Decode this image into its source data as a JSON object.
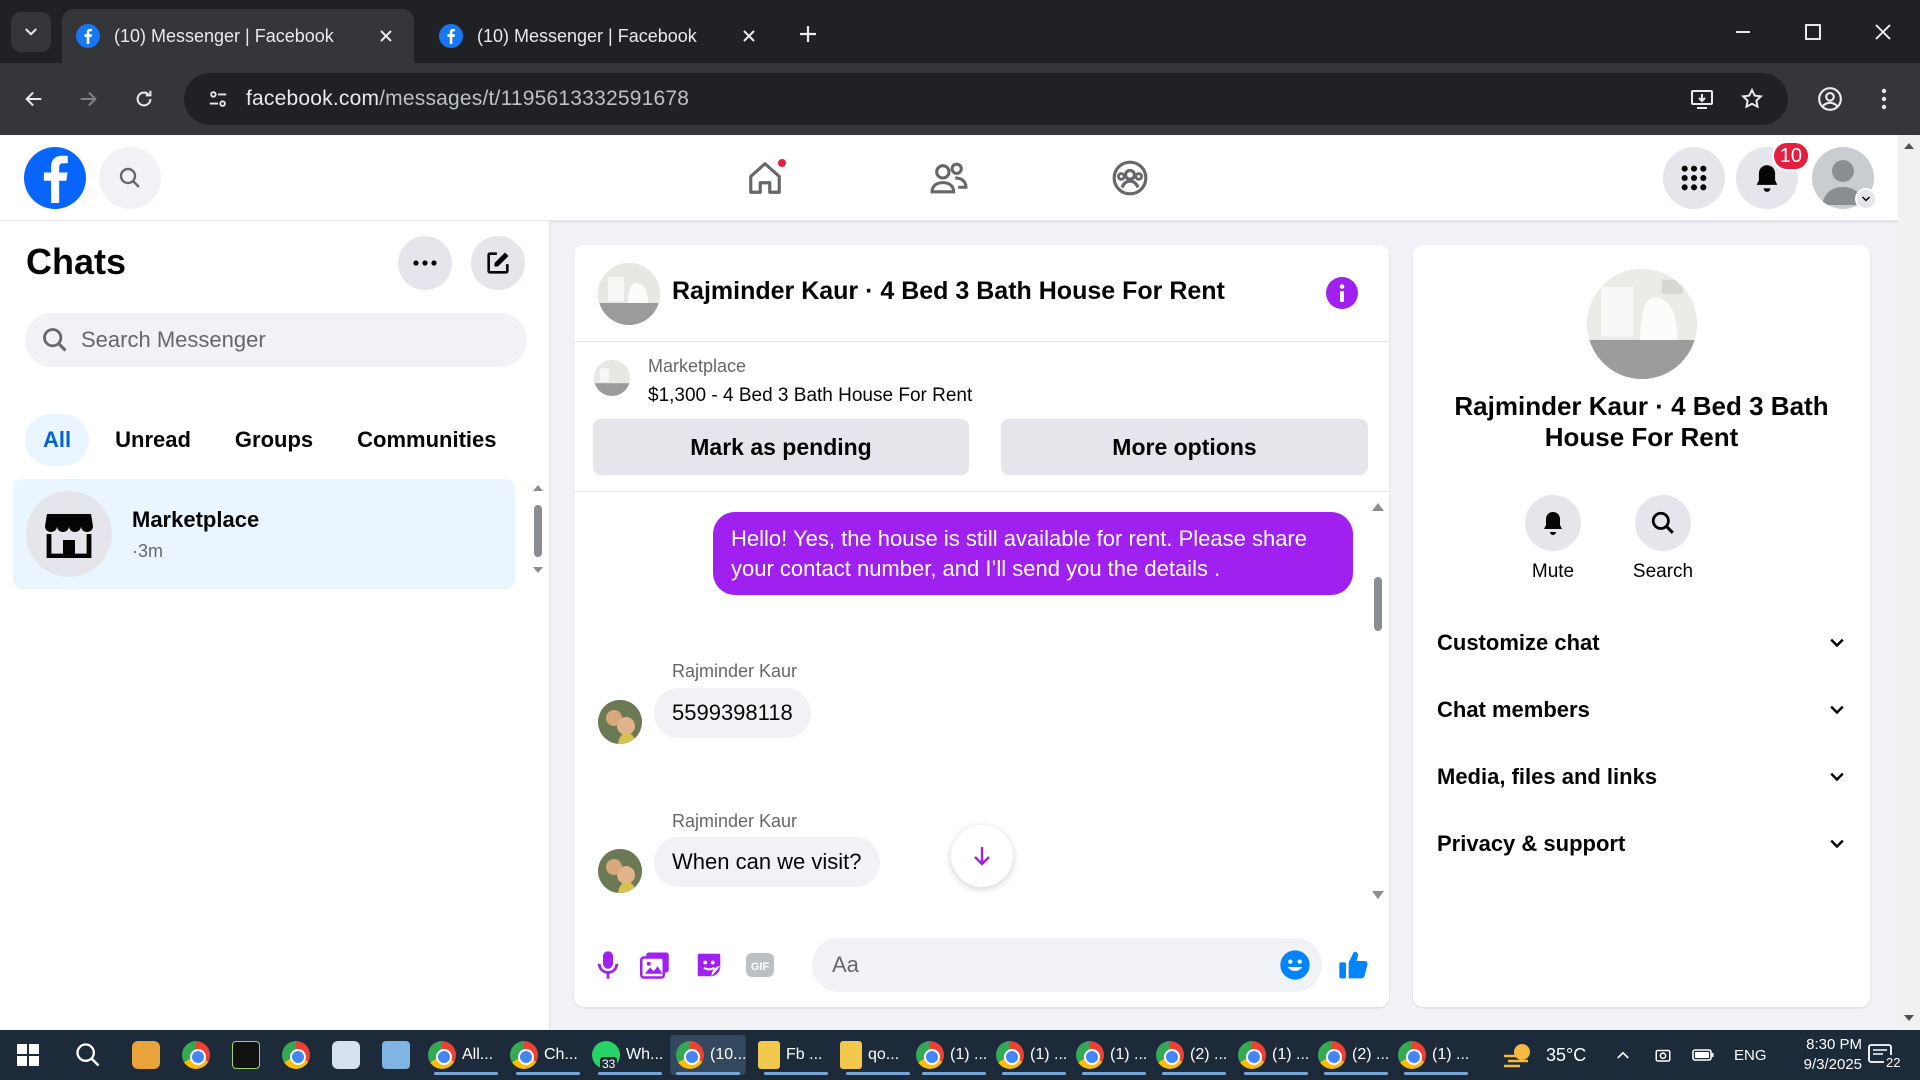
{
  "browser": {
    "tabs": [
      {
        "title": "(10) Messenger | Facebook",
        "active": true
      },
      {
        "title": "(10) Messenger | Facebook",
        "active": false
      }
    ],
    "url_host": "facebook.com",
    "url_path": "/messages/t/1195613332591678"
  },
  "header": {
    "notifications_count": "10"
  },
  "sidebar": {
    "title": "Chats",
    "search_placeholder": "Search Messenger",
    "filters": [
      "All",
      "Unread",
      "Groups",
      "Communities"
    ],
    "active_filter": "All",
    "conversations": [
      {
        "name": "Marketplace",
        "time": "·3m"
      }
    ]
  },
  "chat": {
    "title": "Rajminder Kaur · 4 Bed 3 Bath House For Rent",
    "marketplace_label": "Marketplace",
    "listing": "$1,300 - 4 Bed 3 Bath House For Rent",
    "mark_pending": "Mark as pending",
    "more_options": "More options",
    "messages": [
      {
        "from": "me",
        "text": "Hello! Yes, the house is still available for rent. Please share your contact number, and I’ll send you the details ."
      },
      {
        "from": "Rajminder Kaur",
        "text": "5599398118"
      },
      {
        "from": "Rajminder Kaur",
        "text": "When can we visit?"
      }
    ],
    "composer_placeholder": "Aa",
    "accent_color": "#a020f0"
  },
  "info_panel": {
    "name": "Rajminder Kaur · 4 Bed 3 Bath House For Rent",
    "actions": [
      "Mute",
      "Search"
    ],
    "sections": [
      "Customize chat",
      "Chat members",
      "Media, files and links",
      "Privacy & support"
    ]
  },
  "taskbar": {
    "apps": [
      {
        "label": "All...",
        "icon": "chrome"
      },
      {
        "label": "Ch...",
        "icon": "chrome"
      },
      {
        "label": "Wh...",
        "icon": "whatsapp",
        "badge": "33"
      },
      {
        "label": "(10...",
        "icon": "chrome",
        "active": true
      },
      {
        "label": "Fb ...",
        "icon": "folder"
      },
      {
        "label": "qo...",
        "icon": "folder"
      },
      {
        "label": "(1) ...",
        "icon": "chrome"
      },
      {
        "label": "(1) ...",
        "icon": "chrome"
      },
      {
        "label": "(1) ...",
        "icon": "chrome"
      },
      {
        "label": "(2) ...",
        "icon": "chrome"
      },
      {
        "label": "(1) ...",
        "icon": "chrome"
      },
      {
        "label": "(2) ...",
        "icon": "chrome"
      },
      {
        "label": "(1) ...",
        "icon": "chrome"
      }
    ],
    "weather": "35°C",
    "language": "ENG",
    "time": "8:30 PM",
    "date": "9/3/2025",
    "notification_count": "22"
  }
}
